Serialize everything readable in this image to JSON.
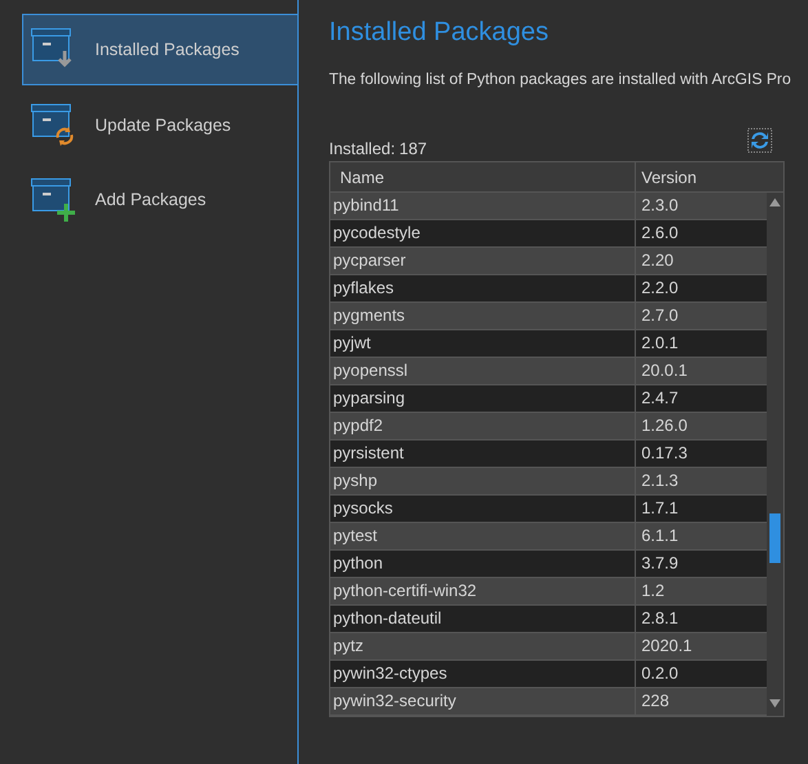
{
  "sidebar": {
    "items": [
      {
        "label": "Installed Packages",
        "kind": "installed",
        "selected": true
      },
      {
        "label": "Update Packages",
        "kind": "update",
        "selected": false
      },
      {
        "label": "Add Packages",
        "kind": "add",
        "selected": false
      }
    ]
  },
  "title": "Installed Packages",
  "description": "The following list of Python packages are installed with ArcGIS Pro",
  "installed_label": "Installed:",
  "installed_count": "187",
  "table": {
    "columns": [
      "Name",
      "Version"
    ],
    "rows": [
      [
        "pybind11",
        "2.3.0"
      ],
      [
        "pycodestyle",
        "2.6.0"
      ],
      [
        "pycparser",
        "2.20"
      ],
      [
        "pyflakes",
        "2.2.0"
      ],
      [
        "pygments",
        "2.7.0"
      ],
      [
        "pyjwt",
        "2.0.1"
      ],
      [
        "pyopenssl",
        "20.0.1"
      ],
      [
        "pyparsing",
        "2.4.7"
      ],
      [
        "pypdf2",
        "1.26.0"
      ],
      [
        "pyrsistent",
        "0.17.3"
      ],
      [
        "pyshp",
        "2.1.3"
      ],
      [
        "pysocks",
        "1.7.1"
      ],
      [
        "pytest",
        "6.1.1"
      ],
      [
        "python",
        "3.7.9"
      ],
      [
        "python-certifi-win32",
        "1.2"
      ],
      [
        "python-dateutil",
        "2.8.1"
      ],
      [
        "pytz",
        "2020.1"
      ],
      [
        "pywin32-ctypes",
        "0.2.0"
      ],
      [
        "pywin32-security",
        "228"
      ]
    ]
  }
}
